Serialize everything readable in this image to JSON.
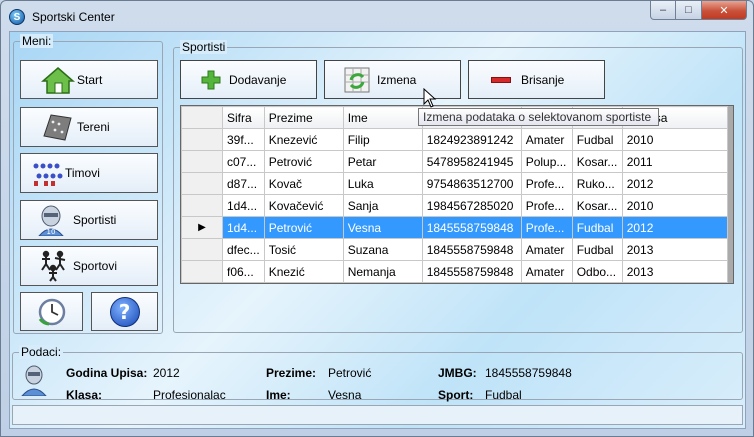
{
  "window": {
    "title": "Sportski Center",
    "min": "–",
    "max": "□",
    "close": "✕"
  },
  "menu": {
    "label": "Meni:",
    "items": [
      {
        "label": "Start",
        "icon": "house-icon"
      },
      {
        "label": "Tereni",
        "icon": "field-icon"
      },
      {
        "label": "Timovi",
        "icon": "team-icon"
      },
      {
        "label": "Sportisti",
        "icon": "athlete-icon"
      },
      {
        "label": "Sportovi",
        "icon": "sports-icon"
      }
    ],
    "bottom": [
      {
        "icon": "clock-icon"
      },
      {
        "icon": "help-icon",
        "glyph": "?"
      }
    ]
  },
  "sportisti": {
    "label": "Sportisti",
    "buttons": {
      "add": "Dodavanje",
      "edit": "Izmena",
      "delete": "Brisanje"
    },
    "tooltip": "Izmena podataka o selektovanom  sportiste"
  },
  "table": {
    "columns": [
      "Sifra",
      "Prezime",
      "Ime",
      "",
      "",
      "",
      "a Upisa"
    ],
    "rows": [
      [
        "39f...",
        "Knezević",
        "Filip",
        "1824923891242",
        "Amater",
        "Fudbal",
        "2010"
      ],
      [
        "c07...",
        "Petrović",
        "Petar",
        "5478958241945",
        "Polup...",
        "Kosar...",
        "2011"
      ],
      [
        "d87...",
        "Kovač",
        "Luka",
        "9754863512700",
        "Profe...",
        "Ruko...",
        "2012"
      ],
      [
        "1d4...",
        "Kovačević",
        "Sanja",
        "1984567285020",
        "Profe...",
        "Kosar...",
        "2010"
      ],
      [
        "1d4...",
        "Petrović",
        "Vesna",
        "1845558759848",
        "Profe...",
        "Fudbal",
        "2012"
      ],
      [
        "dfec...",
        "Tosić",
        "Suzana",
        "1845558759848",
        "Amater",
        "Fudbal",
        "2013"
      ],
      [
        "f06...",
        "Knezić",
        "Nemanja",
        "1845558759848",
        "Amater",
        "Odbo...",
        "2013"
      ]
    ],
    "selected_row": 4,
    "row_indicator": "▶"
  },
  "podaci": {
    "label": "Podaci:",
    "godina_upisa_label": "Godina Upisa:",
    "godina_upisa": "2012",
    "klasa_label": "Klasa:",
    "klasa": "Profesionalac",
    "prezime_label": "Prezime:",
    "prezime": "Petrović",
    "ime_label": "Ime:",
    "ime": "Vesna",
    "jmbg_label": "JMBG:",
    "jmbg": "1845558759848",
    "sport_label": "Sport:",
    "sport": "Fudbal"
  }
}
